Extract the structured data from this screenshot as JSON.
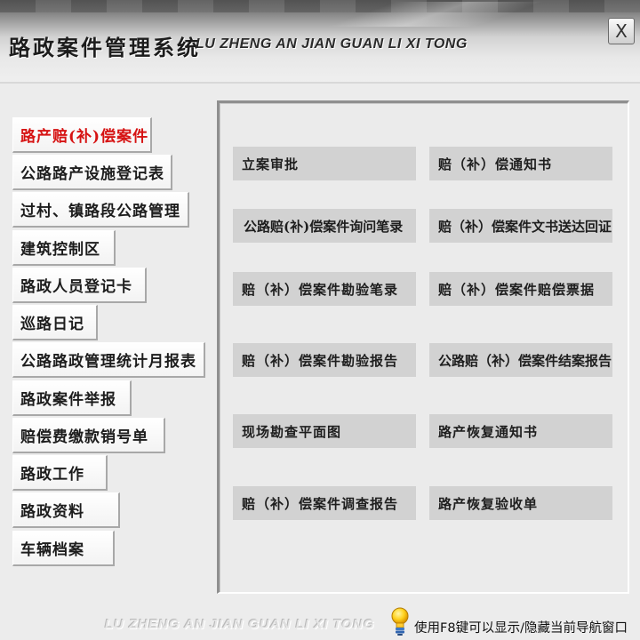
{
  "header": {
    "title": "路政案件管理系统",
    "subtitle": "LU ZHENG AN JIAN GUAN LI XI TONG",
    "close_label": "X"
  },
  "sidebar": {
    "items": [
      {
        "label": "路产赔(补)偿案件",
        "active": true
      },
      {
        "label": "公路路产设施登记表"
      },
      {
        "label": "过村、镇路段公路管理"
      },
      {
        "label": "建筑控制区"
      },
      {
        "label": "路政人员登记卡"
      },
      {
        "label": "巡路日记"
      },
      {
        "label": "公路路政管理统计月报表"
      },
      {
        "label": "路政案件举报"
      },
      {
        "label": "赔偿费缴款销号单"
      },
      {
        "label": "路政工作"
      },
      {
        "label": "路政资料"
      },
      {
        "label": "车辆档案"
      }
    ]
  },
  "main": {
    "buttons": [
      {
        "label": "立案审批"
      },
      {
        "label": "赔（补）偿通知书"
      },
      {
        "label": "公路赔(补)偿案件询问笔录"
      },
      {
        "label": "赔（补）偿案件文书送达回证"
      },
      {
        "label": "赔（补）偿案件勘验笔录"
      },
      {
        "label": "赔（补）偿案件赔偿票据"
      },
      {
        "label": "赔（补）偿案件勘验报告"
      },
      {
        "label": "公路赔（补）偿案件结案报告"
      },
      {
        "label": "现场勘查平面图"
      },
      {
        "label": "路产恢复通知书"
      },
      {
        "label": "赔（补）偿案件调查报告"
      },
      {
        "label": "路产恢复验收单"
      }
    ]
  },
  "footer": {
    "brand": "LU ZHENG AN JIAN GUAN LI XI TONG",
    "hint": "使用F8键可以显示/隐藏当前导航窗口",
    "hint_icon": "lightbulb-icon"
  },
  "colors": {
    "active_nav_text": "#d61313",
    "button_bg": "#d2d2d2",
    "panel_bg": "#ebebeb"
  }
}
